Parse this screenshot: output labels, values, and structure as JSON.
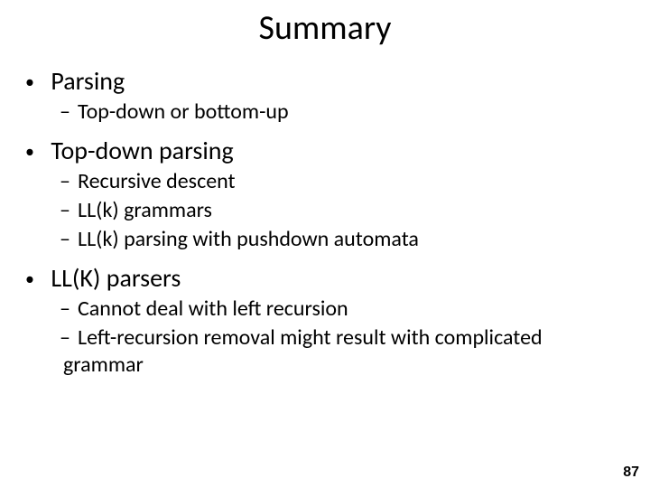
{
  "title": "Summary",
  "bullets": [
    {
      "text": "Parsing",
      "sub": [
        "Top-down or bottom-up"
      ]
    },
    {
      "text": "Top-down parsing",
      "sub": [
        "Recursive descent",
        "LL(k) grammars",
        "LL(k) parsing with pushdown automata"
      ]
    },
    {
      "text": "LL(K) parsers",
      "sub": [
        "Cannot deal with left recursion",
        "Left-recursion removal might result with complicated grammar"
      ]
    }
  ],
  "page_number": "87"
}
